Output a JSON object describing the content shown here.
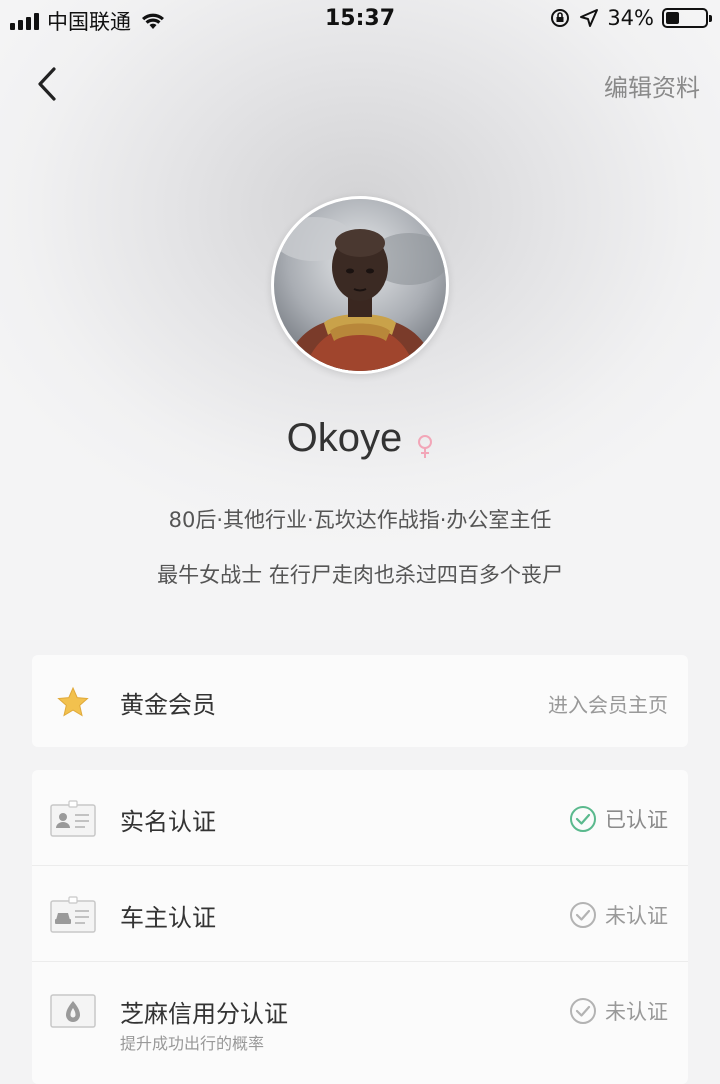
{
  "status_bar": {
    "carrier": "中国联通",
    "time": "15:37",
    "battery": "34%",
    "battery_level": 0.34
  },
  "nav": {
    "edit_label": "编辑资料"
  },
  "profile": {
    "name": "Okoye",
    "info": "80后·其他行业·瓦坎达作战指·办公室主任",
    "bio": "最牛女战士 在行尸走肉也杀过四百多个丧尸"
  },
  "vip": {
    "label": "黄金会员",
    "link": "进入会员主页"
  },
  "verifications": [
    {
      "label": "实名认证",
      "status": "已认证",
      "verified": true,
      "icon": "id-card-icon"
    },
    {
      "label": "车主认证",
      "status": "未认证",
      "verified": false,
      "icon": "car-card-icon"
    },
    {
      "label": "芝麻信用分认证",
      "sub": "提升成功出行的概率",
      "status": "未认证",
      "verified": false,
      "icon": "sesame-icon"
    }
  ],
  "colors": {
    "verified_green": "#5ab98d",
    "gender_pink": "#f2a6b8",
    "star_gold": "#f2c14e"
  }
}
